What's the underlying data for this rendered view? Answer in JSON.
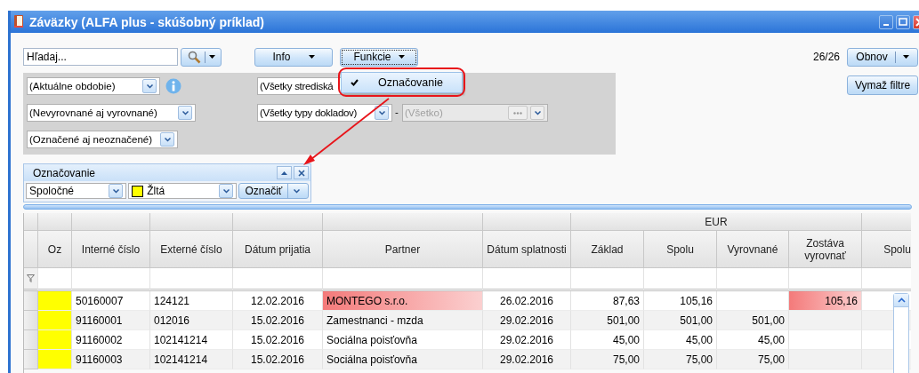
{
  "window": {
    "title": "Záväzky (ALFA plus - skúšobný príklad)"
  },
  "toolbar": {
    "search": {
      "placeholder": "Hľadaj..."
    },
    "info_button": "Info",
    "functions_button": "Funkcie",
    "record_count": "26/26",
    "refresh_button": "Obnov",
    "clear_filters_button": "Vymaž filtre"
  },
  "functions_menu": {
    "items": [
      {
        "label": "Označovanie",
        "checked": true
      }
    ]
  },
  "filters": {
    "left": [
      {
        "value": "(Aktuálne obdobie)",
        "info": true
      },
      {
        "value": "(Nevyrovnané aj vyrovnané)"
      },
      {
        "value": "(Označené aj neoznačené)"
      }
    ],
    "center": [
      {
        "value": "(Všetky strediská"
      },
      {
        "value": "(Všetky typy dokladov)",
        "separator": "-",
        "sub_value": "(Všetko)",
        "sub_disabled": true
      }
    ]
  },
  "marking_panel": {
    "title": "Označovanie",
    "scope": "Spoločné",
    "color_name": "Žltá",
    "color": "#ffff00",
    "mark_button": "Označiť"
  },
  "table": {
    "columns": [
      {
        "label": "Oz"
      },
      {
        "label": "Interné číslo"
      },
      {
        "label": "Externé číslo"
      },
      {
        "label": "Dátum prijatia"
      },
      {
        "label": "Partner"
      },
      {
        "label": "Dátum splatnosti"
      },
      {
        "label": "EUR",
        "children": [
          {
            "label": "Základ"
          },
          {
            "label": "Spolu"
          },
          {
            "label": "Vyrovnané"
          },
          {
            "label": "Zostáva vyrovnať"
          }
        ]
      },
      {
        "label": "Spolu"
      }
    ],
    "rows": [
      {
        "cells": [
          {
            "color": "#ffff00"
          },
          {
            "text": "50160007",
            "highlighted": false
          },
          {
            "text": "124121",
            "highlighted": false
          },
          {
            "text": "12.02.2016",
            "highlighted": false
          },
          {
            "text": "MONTEGO s.r.o.",
            "highlighted": true
          },
          {
            "text": "26.02.2016",
            "highlighted": false
          },
          {
            "text": "87,63",
            "highlighted": false
          },
          {
            "text": "105,16",
            "highlighted": false
          },
          {
            "highlighted": false
          },
          {
            "text": "105,16",
            "highlighted": true
          },
          {
            "highlighted": false
          }
        ]
      },
      {
        "cells": [
          {
            "color": "#ffff00"
          },
          {
            "text": "91160001",
            "highlighted": false
          },
          {
            "text": "012016",
            "highlighted": false
          },
          {
            "text": "15.02.2016",
            "highlighted": false
          },
          {
            "text": "Zamestnanci - mzda",
            "highlighted": false
          },
          {
            "text": "29.02.2016",
            "highlighted": false
          },
          {
            "text": "501,00",
            "highlighted": false
          },
          {
            "text": "501,00",
            "highlighted": false
          },
          {
            "text": "501,00",
            "highlighted": false
          },
          {
            "highlighted": false
          },
          {
            "highlighted": false
          }
        ]
      },
      {
        "cells": [
          {
            "color": "#ffff00"
          },
          {
            "text": "91160002",
            "highlighted": false
          },
          {
            "text": "102141214",
            "highlighted": false
          },
          {
            "text": "15.02.2016",
            "highlighted": false
          },
          {
            "text": "Sociálna poisťovňa",
            "highlighted": false
          },
          {
            "text": "29.02.2016",
            "highlighted": false
          },
          {
            "text": "45,00",
            "highlighted": false
          },
          {
            "text": "45,00",
            "highlighted": false
          },
          {
            "text": "45,00",
            "highlighted": false
          },
          {
            "highlighted": false
          },
          {
            "highlighted": false
          }
        ]
      },
      {
        "cells": [
          {
            "color": "#ffff00"
          },
          {
            "text": "91160003",
            "highlighted": false
          },
          {
            "text": "102141214",
            "highlighted": false
          },
          {
            "text": "15.02.2016",
            "highlighted": false
          },
          {
            "text": "Sociálna poisťovňa",
            "highlighted": false
          },
          {
            "text": "29.02.2016",
            "highlighted": false
          },
          {
            "text": "75,00",
            "highlighted": false
          },
          {
            "text": "75,00",
            "highlighted": false
          },
          {
            "text": "75,00",
            "highlighted": false
          },
          {
            "highlighted": false
          },
          {
            "highlighted": false
          }
        ]
      }
    ]
  }
}
